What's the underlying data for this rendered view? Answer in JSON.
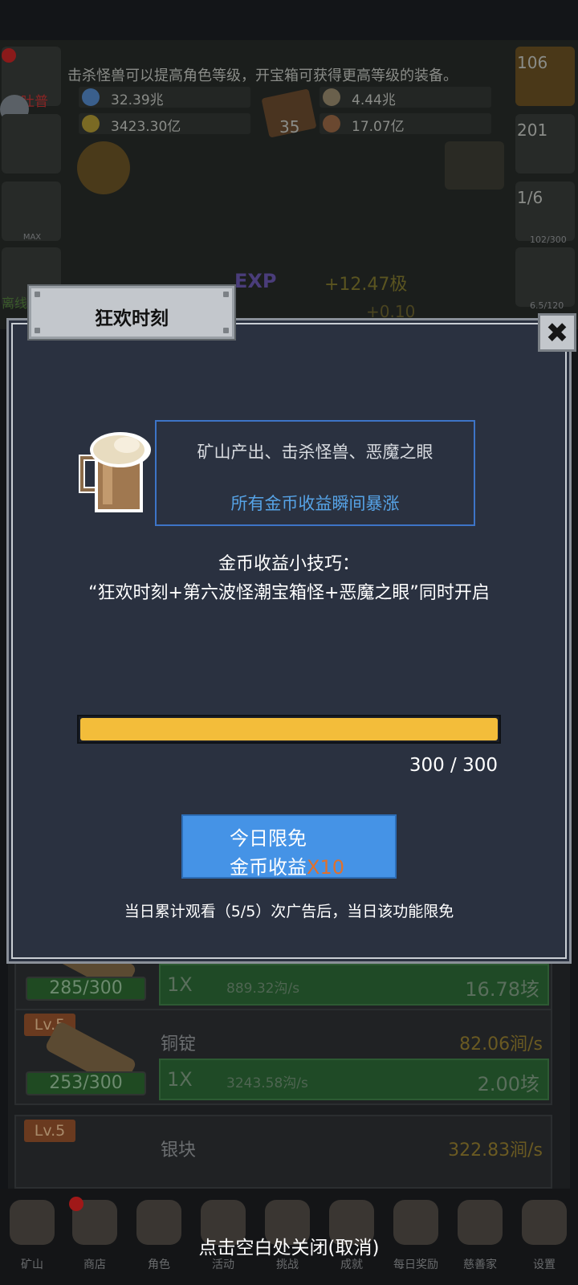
{
  "background": {
    "hint": "击杀怪兽可以提高角色等级，开宝箱可获得更高等级的装备。",
    "resources": [
      "32.39兆",
      "4.44兆",
      "3423.30亿",
      "17.07亿"
    ],
    "book_count": "35",
    "left_slots": [
      "MAX",
      "离线"
    ],
    "left_slot_badge": "吐普",
    "right_slots": [
      "106",
      "201",
      "1/6",
      "102/300",
      "6.5/120"
    ],
    "exp_label": "EXP",
    "level_gain": "+12.47极",
    "level_gain_2": "+0.10",
    "rows": [
      {
        "name": "",
        "level": "",
        "progress": "285/300",
        "multiplier": "1X",
        "sub_rate": "889.32沟/s",
        "value": "16.78垓",
        "rate": ""
      },
      {
        "name": "铜锭",
        "level": "Lv.5",
        "progress": "253/300",
        "multiplier": "1X",
        "sub_rate": "3243.58沟/s",
        "value": "2.00垓",
        "rate": "82.06涧/s"
      },
      {
        "name": "银块",
        "level": "Lv.5",
        "progress": "",
        "multiplier": "",
        "sub_rate": "",
        "value": "",
        "rate": "322.83涧/s"
      }
    ],
    "nav": [
      "矿山",
      "商店",
      "角色",
      "活动",
      "挑战",
      "成就",
      "每日奖励",
      "慈善家",
      "设置"
    ]
  },
  "modal": {
    "title": "狂欢时刻",
    "close_symbol": "✖",
    "info_line1": "矿山产出、击杀怪兽、恶魔之眼",
    "info_line2": "所有金币收益瞬间暴涨",
    "tip_title": "金币收益小技巧：",
    "tip_body": "“狂欢时刻+第六波怪潮宝箱怪+恶魔之眼”同时开启",
    "progress": {
      "current": 300,
      "max": 300,
      "text": "300 / 300"
    },
    "cta_line1": "今日限免",
    "cta_line2": "金币收益",
    "cta_multiplier": "X10",
    "cta_note": "当日累计观看（5/5）次广告后，当日该功能限免"
  },
  "close_hint": "点击空白处关闭(取消)",
  "colors": {
    "accent_blue": "#4593e6",
    "progress_yellow": "#f3bd3a",
    "multiplier_orange": "#e0702c",
    "info_blue": "#56a3e6"
  }
}
